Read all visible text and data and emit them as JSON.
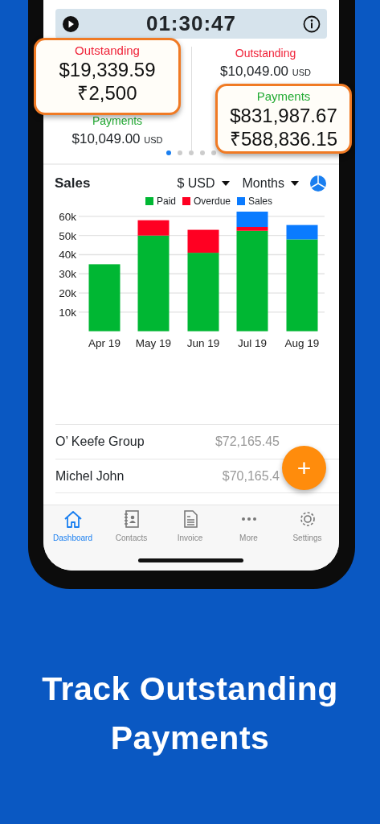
{
  "timer": {
    "time": "01:30:47"
  },
  "stats": [
    {
      "kind": "outstanding",
      "label": "Outstanding",
      "amount": "$10,049.00",
      "unit": "USD"
    },
    {
      "kind": "payments",
      "label": "Payments",
      "amount": "$10,049.00",
      "unit": "USD"
    }
  ],
  "callouts": [
    {
      "kind": "outstanding",
      "label": "Outstanding",
      "lines": [
        "$19,339.59",
        "₹2,500"
      ]
    },
    {
      "kind": "payments",
      "label": "Payments",
      "lines": [
        "$831,987.67",
        "₹588,836.15"
      ]
    }
  ],
  "pager": [
    {
      "selected": true
    },
    {
      "selected": false
    },
    {
      "selected": false
    },
    {
      "selected": false
    },
    {
      "selected": false
    }
  ],
  "sales": {
    "title": "Sales",
    "currency": "$ USD",
    "period": "Months",
    "chart_data": {
      "type": "bar",
      "stacked": true,
      "categories": [
        "Apr 19",
        "May 19",
        "Jun 19",
        "Jul 19",
        "Aug 19"
      ],
      "series": [
        {
          "name": "Paid",
          "color": "#00b733",
          "values": [
            35000,
            50000,
            41000,
            52500,
            48000
          ]
        },
        {
          "name": "Overdue",
          "color": "#ff0022",
          "values": [
            null,
            8000,
            12000,
            2000,
            null
          ]
        },
        {
          "name": "Sales",
          "color": "#0a7bff",
          "values": [
            null,
            null,
            null,
            8000,
            7500
          ]
        }
      ],
      "ylim": [
        0,
        63000
      ],
      "grid": true,
      "legend": true,
      "yticks": [
        {
          "value": 10000,
          "label": "10k"
        },
        {
          "value": 20000,
          "label": "20k"
        },
        {
          "value": 30000,
          "label": "30k"
        },
        {
          "value": 40000,
          "label": "40k"
        },
        {
          "value": 50000,
          "label": "50k"
        },
        {
          "value": 60000,
          "label": "60k"
        }
      ]
    }
  },
  "rows": [
    {
      "name": "O’ Keefe Group",
      "amount": "$72,165.45"
    },
    {
      "name": "Michel John",
      "amount": "$70,165.4"
    }
  ],
  "fab": {
    "label": "+"
  },
  "tabs": [
    {
      "kind": "home",
      "label": "Dashboard",
      "selected": true
    },
    {
      "kind": "contacts",
      "label": "Contacts",
      "selected": false
    },
    {
      "kind": "invoice",
      "label": "Invoice",
      "selected": false
    },
    {
      "kind": "more",
      "label": "More",
      "selected": false
    },
    {
      "kind": "settings",
      "label": "Settings",
      "selected": false
    }
  ],
  "headline": "Track Outstanding Payments"
}
